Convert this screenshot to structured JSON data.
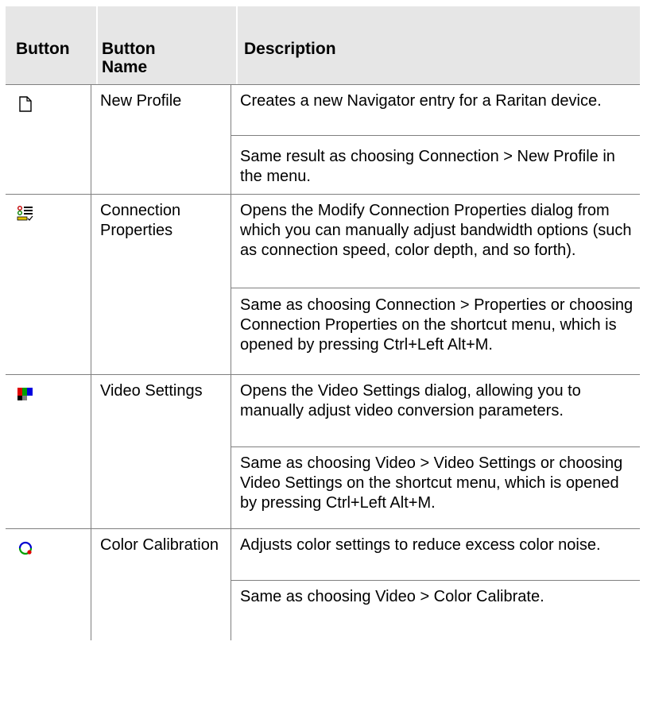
{
  "table": {
    "headers": {
      "button": "Button",
      "button_name": "Button Name",
      "description": "Description"
    },
    "rows": [
      {
        "icon": "new-profile-icon",
        "name": "New Profile",
        "desc1": "Creates a new Navigator entry for a Raritan device.",
        "desc2": "Same result as choosing Connection > New Profile in the menu."
      },
      {
        "icon": "connection-properties-icon",
        "name": "Connection Properties",
        "desc1": "Opens the Modify Connection Properties dialog from which you can manually adjust bandwidth options (such as connection speed, color depth, and so forth).",
        "desc2": "Same as choosing Connection > Properties or choosing Connection Properties on the shortcut menu, which is opened by pressing Ctrl+Left Alt+M."
      },
      {
        "icon": "video-settings-icon",
        "name": "Video Settings",
        "desc1": "Opens the Video Settings dialog, allowing you to manually adjust video conversion parameters.",
        "desc2": "Same as choosing Video > Video Settings or choosing Video Settings on the shortcut menu, which is opened by pressing Ctrl+Left Alt+M."
      },
      {
        "icon": "color-calibration-icon",
        "name": "Color Calibration",
        "desc1": "Adjusts color settings to reduce excess color noise.",
        "desc2": "Same as choosing Video > Color Calibrate."
      }
    ]
  }
}
